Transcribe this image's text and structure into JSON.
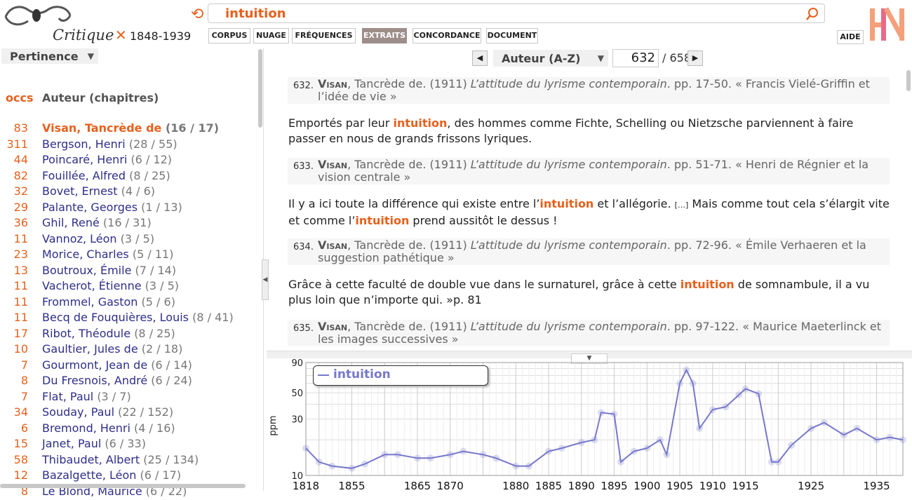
{
  "app": {
    "brand": "Critique",
    "period": "1848-1939",
    "query": "intuition",
    "tabs": [
      "CORPUS",
      "NUAGE",
      "FRÉQUENCES",
      "EXTRAITS",
      "CONCORDANCE",
      "DOCUMENT"
    ],
    "active_tab": "EXTRAITS",
    "help": "AIDE",
    "accent": "#e8601c"
  },
  "sidebar": {
    "sort_label": "Pertinence",
    "col_occs": "occs",
    "col_author": "Auteur (chapitres)",
    "items": [
      {
        "n": "83",
        "name": "Visan, Tancrède de",
        "cnt": "(16 / 17)"
      },
      {
        "n": "311",
        "name": "Bergson, Henri",
        "cnt": "(28 / 55)"
      },
      {
        "n": "44",
        "name": "Poincaré, Henri",
        "cnt": "(6 / 12)"
      },
      {
        "n": "82",
        "name": "Fouillée, Alfred",
        "cnt": "(8 / 25)"
      },
      {
        "n": "32",
        "name": "Bovet, Ernest",
        "cnt": "(4 / 6)"
      },
      {
        "n": "29",
        "name": "Palante, Georges",
        "cnt": "(1 / 13)"
      },
      {
        "n": "36",
        "name": "Ghil, René",
        "cnt": "(16 / 31)"
      },
      {
        "n": "11",
        "name": "Vannoz, Léon",
        "cnt": "(3 / 5)"
      },
      {
        "n": "23",
        "name": "Morice, Charles",
        "cnt": "(5 / 11)"
      },
      {
        "n": "13",
        "name": "Boutroux, Émile",
        "cnt": "(7 / 14)"
      },
      {
        "n": "11",
        "name": "Vacherot, Étienne",
        "cnt": "(3 / 5)"
      },
      {
        "n": "11",
        "name": "Frommel, Gaston",
        "cnt": "(5 / 6)"
      },
      {
        "n": "11",
        "name": "Becq de Fouquières, Louis",
        "cnt": "(8 / 41)"
      },
      {
        "n": "17",
        "name": "Ribot, Théodule",
        "cnt": "(8 / 25)"
      },
      {
        "n": "10",
        "name": "Gaultier, Jules de",
        "cnt": "(2 / 18)"
      },
      {
        "n": "7",
        "name": "Gourmont, Jean de",
        "cnt": "(6 / 14)"
      },
      {
        "n": "8",
        "name": "Du Fresnois, André",
        "cnt": "(6 / 24)"
      },
      {
        "n": "7",
        "name": "Flat, Paul",
        "cnt": "(3 / 7)"
      },
      {
        "n": "34",
        "name": "Souday, Paul",
        "cnt": "(22 / 152)"
      },
      {
        "n": "6",
        "name": "Bremond, Henri",
        "cnt": "(4 / 16)"
      },
      {
        "n": "15",
        "name": "Janet, Paul",
        "cnt": "(6 / 33)"
      },
      {
        "n": "58",
        "name": "Thibaudet, Albert",
        "cnt": "(25 / 134)"
      },
      {
        "n": "12",
        "name": "Bazalgette, Léon",
        "cnt": "(6 / 17)"
      },
      {
        "n": "8",
        "name": "Le Blond, Maurice",
        "cnt": "(6 / 22)"
      }
    ]
  },
  "nav": {
    "sort_label": "Auteur (A-Z)",
    "page": "632",
    "total": "/ 658"
  },
  "extracts": {
    "r1": {
      "num": "632.",
      "author": "Visan",
      "rest": ", Tancrède de. (1911) ",
      "title": "L’attitude du lyrisme contemporain",
      "tail": ". pp. 17-50. « Francis Vielé-Griffin et l’idée de vie »"
    },
    "p1": {
      "a": "Emportés par leur ",
      "hl": "intuition",
      "b": ", des hommes comme Fichte, Schelling ou Nietzsche parviennent à faire passer en nous de grands frissons lyriques."
    },
    "r2": {
      "num": "633.",
      "author": "Visan",
      "rest": ", Tancrède de. (1911) ",
      "title": "L’attitude du lyrisme contemporain",
      "tail": ". pp. 51-71. « Henri de Régnier et la vision centrale »"
    },
    "p2": {
      "a": "Il y a ici toute la différence qui existe entre l’",
      "hl1": "intuition",
      "b": " et l’allégorie. ",
      "ellip": "[…]",
      "c": " Mais comme tout cela s’élargit vite et comme l’",
      "hl2": "intuition",
      "d": " prend aussitôt le dessus !"
    },
    "r3": {
      "num": "634.",
      "author": "Visan",
      "rest": ", Tancrède de. (1911) ",
      "title": "L’attitude du lyrisme contemporain",
      "tail": ". pp. 72-96. « Émile Verhaeren et la suggestion pathétique »"
    },
    "p3": {
      "a": "Grâce à cette faculté de double vue dans le surnaturel, grâce à cette ",
      "hl": "intuition",
      "b": " de somnambule, il a vu plus loin que n’importe qui. »p. 81"
    },
    "r4": {
      "num": "635.",
      "author": "Visan",
      "rest": ", Tancrède de. (1911) ",
      "title": "L’attitude du lyrisme contemporain",
      "tail": ". pp. 97-122. « Maurice Maeterlinck et les images successives »"
    }
  },
  "chart_data": {
    "type": "line",
    "series": [
      {
        "name": "intuition",
        "color": "#7777cc",
        "x": [
          1848,
          1850,
          1852,
          1855,
          1857,
          1860,
          1862,
          1865,
          1867,
          1870,
          1872,
          1875,
          1877,
          1880,
          1882,
          1885,
          1887,
          1890,
          1892,
          1893,
          1895,
          1896,
          1898,
          1900,
          1902,
          1903,
          1905,
          1906,
          1907,
          1908,
          1910,
          1912,
          1914,
          1915,
          1917,
          1919,
          1920,
          1922,
          1925,
          1927,
          1930,
          1932,
          1935,
          1937,
          1939
        ],
        "y": [
          17,
          13,
          12,
          11.5,
          12.5,
          15,
          15,
          14,
          14,
          15,
          16,
          15,
          14,
          12,
          12,
          16,
          17,
          19,
          20,
          34,
          33,
          13,
          16,
          17,
          20,
          15,
          60,
          78,
          60,
          25,
          36,
          38,
          48,
          54,
          49,
          13,
          13,
          18,
          25,
          28,
          22,
          25,
          20,
          21,
          20
        ]
      }
    ],
    "yticks": [
      "90",
      "50",
      "30",
      "10"
    ],
    "ylabel": "ppm",
    "xticks": [
      "1818",
      "1855",
      "1865",
      "1870",
      "1880",
      "1885",
      "1890",
      "1895",
      "1900",
      "1905",
      "1910",
      "1915",
      "1925",
      "1935"
    ],
    "yscale": "log",
    "ylim": [
      10,
      90
    ],
    "xlim": [
      1848,
      1939
    ],
    "grid": true,
    "legend_position": "top-left"
  }
}
